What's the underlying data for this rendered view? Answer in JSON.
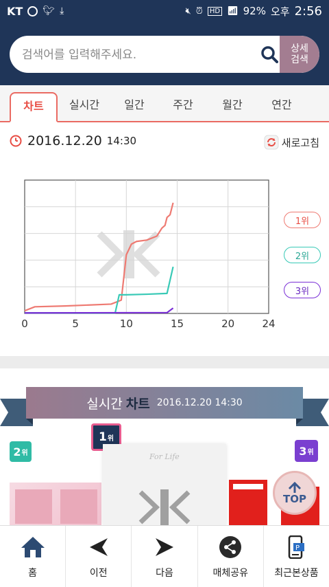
{
  "status_bar": {
    "carrier": "KT",
    "battery": "92%",
    "ampm": "오후",
    "clock": "2:56"
  },
  "search": {
    "placeholder": "검색어를 입력해주세요.",
    "advanced_label": "상세 검색"
  },
  "tabs": [
    {
      "label": "차트",
      "active": true
    },
    {
      "label": "실시간"
    },
    {
      "label": "일간"
    },
    {
      "label": "주간"
    },
    {
      "label": "월간"
    },
    {
      "label": "연간"
    }
  ],
  "timestamp": {
    "date": "2016.12.20",
    "time": "14:30"
  },
  "refresh_label": "새로고침",
  "chart_data": {
    "type": "line",
    "xlim": [
      0,
      24
    ],
    "ylim": [
      0,
      5
    ],
    "xticks": [
      0,
      5,
      10,
      15,
      20,
      24
    ],
    "grid": true,
    "legend": "right",
    "series": [
      {
        "name": "1위",
        "color": "#ee7a72",
        "x": [
          0,
          1,
          4,
          8.5,
          9.5,
          10,
          10.5,
          11,
          12,
          13,
          13.5,
          13.8,
          14,
          14.3,
          14.6
        ],
        "y": [
          0.1,
          0.25,
          0.28,
          0.35,
          0.5,
          2.2,
          2.6,
          2.7,
          2.75,
          2.9,
          3.2,
          3.3,
          3.6,
          3.7,
          4.15
        ]
      },
      {
        "name": "2위",
        "color": "#38c9b6",
        "x": [
          0,
          8.6,
          8.9,
          9.3,
          10,
          12,
          14,
          14,
          14.6
        ],
        "y": [
          0.02,
          0.02,
          0.02,
          0.7,
          0.7,
          0.72,
          0.75,
          0.75,
          1.75
        ]
      },
      {
        "name": "3위",
        "color": "#7a2fd6",
        "x": [
          0,
          14,
          14.6
        ],
        "y": [
          0.02,
          0.03,
          0.2
        ]
      }
    ]
  },
  "realtime_banner": {
    "title_a": "실시간",
    "title_b": "차트",
    "timestamp": "2016.12.20 14:30"
  },
  "products": [
    {
      "rank": "2",
      "suffix": "위"
    },
    {
      "rank": "1",
      "suffix": "위",
      "cover_text": "For Life"
    },
    {
      "rank": "3",
      "suffix": "위"
    }
  ],
  "top_button": "TOP",
  "bottom_nav": [
    {
      "label": "홈",
      "icon": "home-icon"
    },
    {
      "label": "이전",
      "icon": "back-arrow-icon"
    },
    {
      "label": "다음",
      "icon": "next-arrow-icon"
    },
    {
      "label": "매체공유",
      "icon": "share-icon"
    },
    {
      "label": "최근본상품",
      "icon": "recent-items-icon"
    }
  ]
}
